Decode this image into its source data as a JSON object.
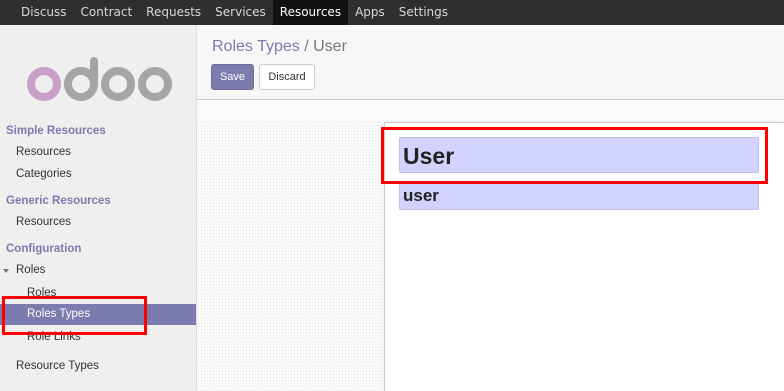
{
  "top_menu": {
    "items": [
      {
        "label": "Discuss",
        "active": false
      },
      {
        "label": "Contract",
        "active": false
      },
      {
        "label": "Requests",
        "active": false
      },
      {
        "label": "Services",
        "active": false
      },
      {
        "label": "Resources",
        "active": true
      },
      {
        "label": "Apps",
        "active": false
      },
      {
        "label": "Settings",
        "active": false
      }
    ]
  },
  "sidebar": {
    "logo_text": "odoo",
    "sections": {
      "simple_resources": {
        "title": "Simple Resources",
        "items": [
          "Resources",
          "Categories"
        ]
      },
      "generic_resources": {
        "title": "Generic Resources",
        "items": [
          "Resources"
        ]
      },
      "configuration": {
        "title": "Configuration",
        "roles_group": "Roles",
        "roles_children": [
          "Roles",
          "Roles Types",
          "Role Links"
        ],
        "active_item": "Roles Types",
        "extra_items": [
          "Resource Types"
        ]
      }
    }
  },
  "header": {
    "breadcrumb_parent": "Roles Types",
    "breadcrumb_separator": "/",
    "breadcrumb_current": "User",
    "save_label": "Save",
    "discard_label": "Discard"
  },
  "form": {
    "name_value": "User",
    "code_value": "user"
  },
  "colors": {
    "brand": "#7c7bad",
    "topbar": "#2f2f2f",
    "field_required": "#d2d2ff",
    "annotation": "#ff0000"
  }
}
